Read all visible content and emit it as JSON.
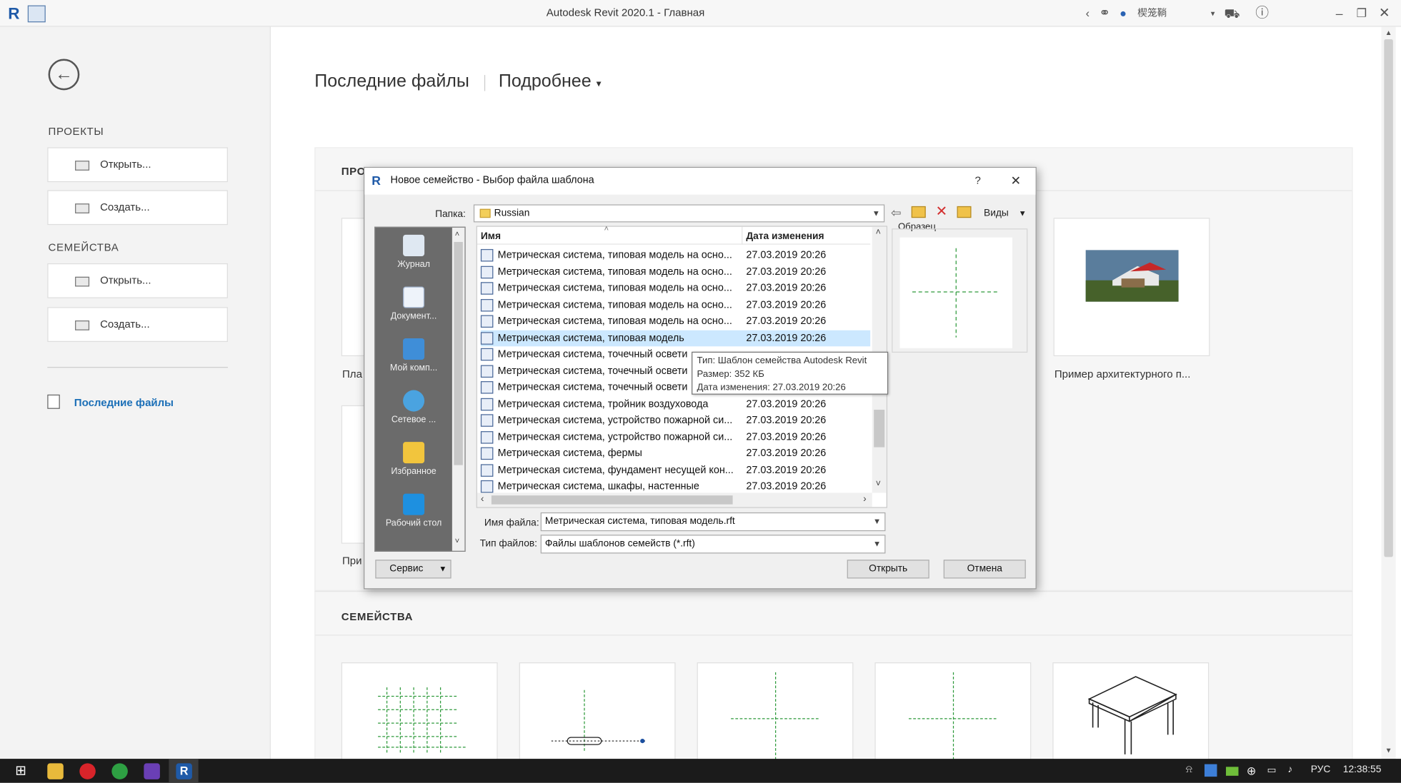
{
  "window": {
    "title": "Autodesk Revit 2020.1 - Главная",
    "user": "楔笼鞝"
  },
  "left_panel": {
    "projects_heading": "ПРОЕКТЫ",
    "projects_open": "Открыть...",
    "projects_create": "Создать...",
    "families_heading": "СЕМЕЙСТВА",
    "families_open": "Открыть...",
    "families_create": "Создать...",
    "recent_files": "Последние файлы"
  },
  "main": {
    "title": "Последние файлы",
    "details_menu": "Подробнее",
    "projects_section": "ПРО",
    "families_section": "СЕМЕЙСТВА",
    "project_thumb_1_label": "Пла",
    "project_thumb_2_label": "При",
    "project_thumb_right_label": "Пример архитектурного п..."
  },
  "dialog": {
    "title": "Новое семейство - Выбор файла шаблона",
    "help": "?",
    "close": "✕",
    "folder_label": "Папка:",
    "folder_value": "Russian",
    "views_label": "Виды",
    "preview_label": "Образец",
    "col_name": "Имя",
    "col_date": "Дата изменения",
    "places": [
      "Журнал",
      "Документ...",
      "Мой комп...",
      "Сетевое ...",
      "Избранное",
      "Рабочий стол"
    ],
    "files": [
      {
        "name": "Метрическая система, типовая модель на осно...",
        "date": "27.03.2019 20:26"
      },
      {
        "name": "Метрическая система, типовая модель на осно...",
        "date": "27.03.2019 20:26"
      },
      {
        "name": "Метрическая система, типовая модель на осно...",
        "date": "27.03.2019 20:26"
      },
      {
        "name": "Метрическая система, типовая модель на осно...",
        "date": "27.03.2019 20:26"
      },
      {
        "name": "Метрическая система, типовая модель на осно...",
        "date": "27.03.2019 20:26"
      },
      {
        "name": "Метрическая система, типовая модель",
        "date": "27.03.2019 20:26"
      },
      {
        "name": "Метрическая система, точечный освети",
        "date": ""
      },
      {
        "name": "Метрическая система, точечный освети",
        "date": ""
      },
      {
        "name": "Метрическая система, точечный освети",
        "date": ""
      },
      {
        "name": "Метрическая система, тройник воздуховода",
        "date": "27.03.2019 20:26"
      },
      {
        "name": "Метрическая система, устройство пожарной си...",
        "date": "27.03.2019 20:26"
      },
      {
        "name": "Метрическая система, устройство пожарной си...",
        "date": "27.03.2019 20:26"
      },
      {
        "name": "Метрическая система, фермы",
        "date": "27.03.2019 20:26"
      },
      {
        "name": "Метрическая система, фундамент несущей кон...",
        "date": "27.03.2019 20:26"
      },
      {
        "name": "Метрическая система, шкафы, настенные",
        "date": "27.03.2019 20:26"
      }
    ],
    "tooltip": {
      "type": "Тип: Шаблон семейства Autodesk Revit",
      "size": "Размер: 352 КБ",
      "modified": "Дата изменения: 27.03.2019 20:26"
    },
    "filename_label": "Имя файла:",
    "filename_value": "Метрическая система, типовая модель.rft",
    "filetype_label": "Тип файлов:",
    "filetype_value": "Файлы шаблонов семейств  (*.rft)",
    "service_button": "Сервис",
    "open_button": "Открыть",
    "cancel_button": "Отмена"
  },
  "taskbar": {
    "lang": "РУС",
    "time": "12:38:55"
  }
}
